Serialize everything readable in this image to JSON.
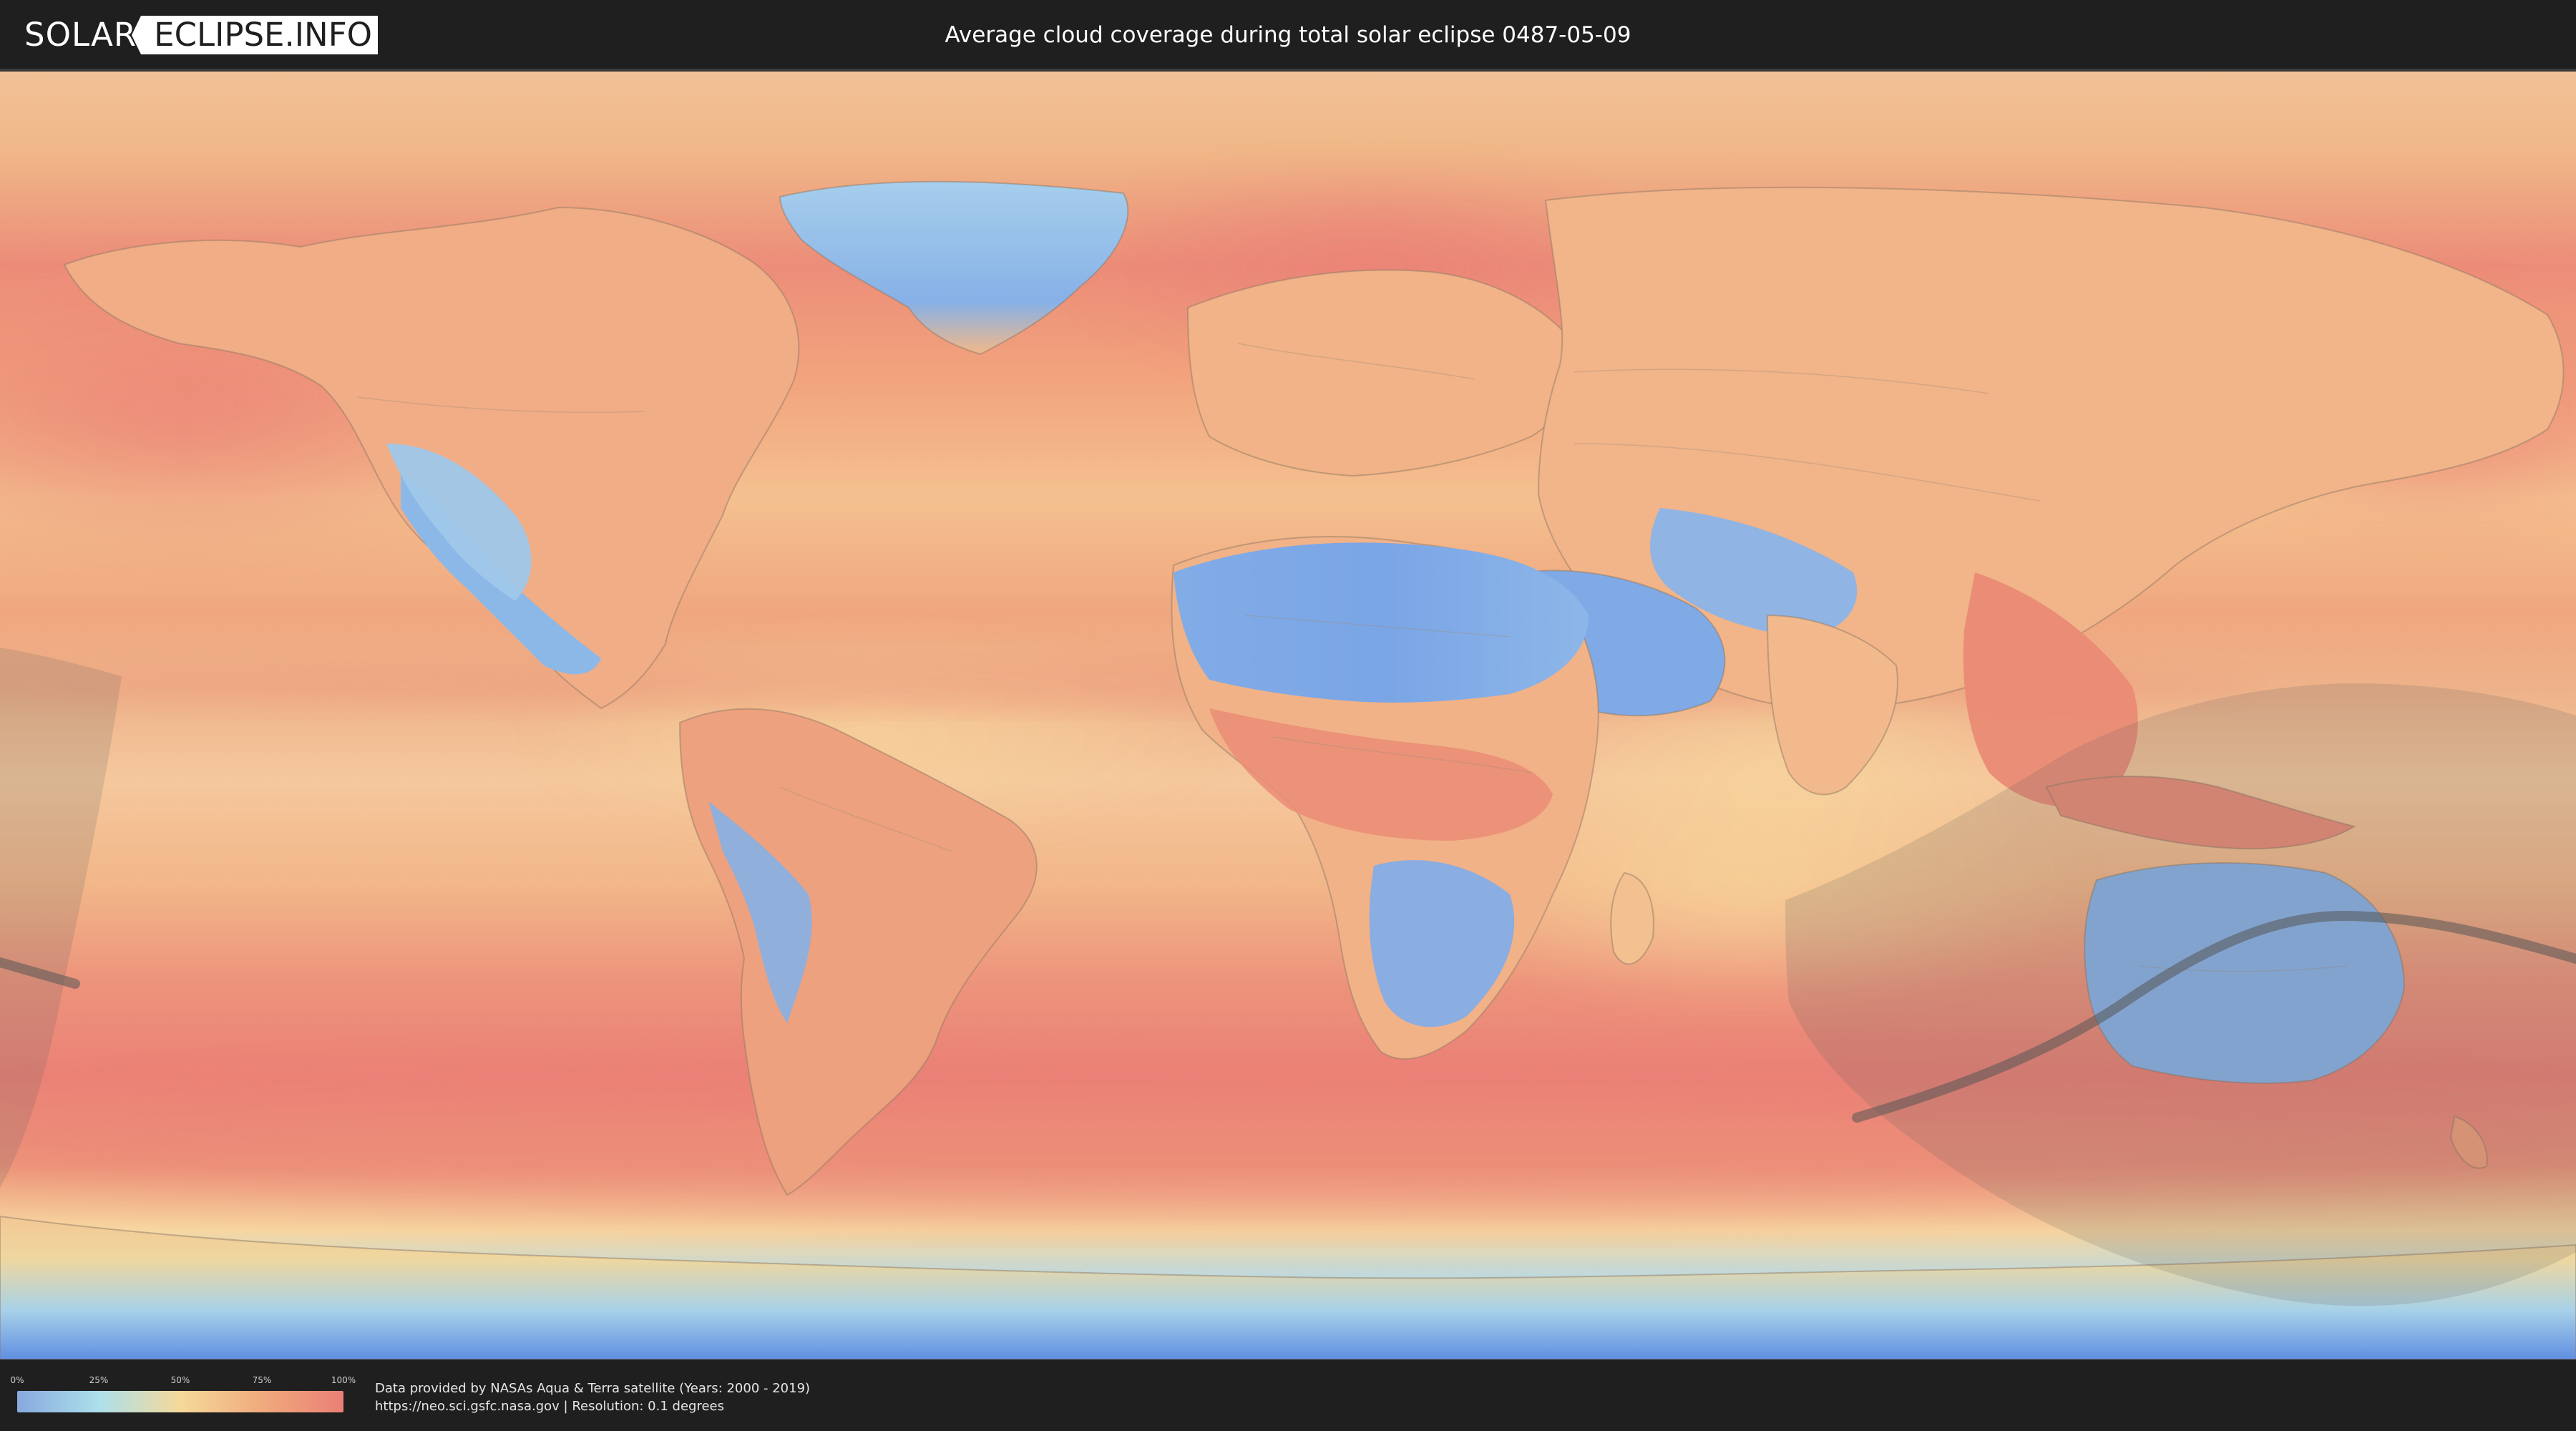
{
  "header": {
    "logo_left": "SOLAR",
    "logo_right": "ECLIPSE.INFO",
    "title": "Average cloud coverage during total solar eclipse 0487-05-09"
  },
  "legend": {
    "ticks": [
      "0%",
      "25%",
      "50%",
      "75%",
      "100%"
    ],
    "colors": [
      "#88a9de",
      "#ace0eb",
      "#f5d99a",
      "#f0aa7c",
      "#ea8076"
    ]
  },
  "footer": {
    "data_source": "Data provided by NASAs Aqua & Terra satellite (Years: 2000 - 2019)",
    "source_line": "https://neo.sci.gsfc.nasa.gov | Resolution: 0.1 degrees"
  },
  "map": {
    "projection": "equirectangular",
    "ocean_colors": [
      "#ec8176",
      "#f09f7b",
      "#f6c89a",
      "#efd79f"
    ],
    "land_colors": [
      "#7fa8e6",
      "#a7d7e8",
      "#f3b487",
      "#e88b73"
    ],
    "eclipse": {
      "shadow_color": "#606060",
      "path_color": "#555555"
    }
  }
}
